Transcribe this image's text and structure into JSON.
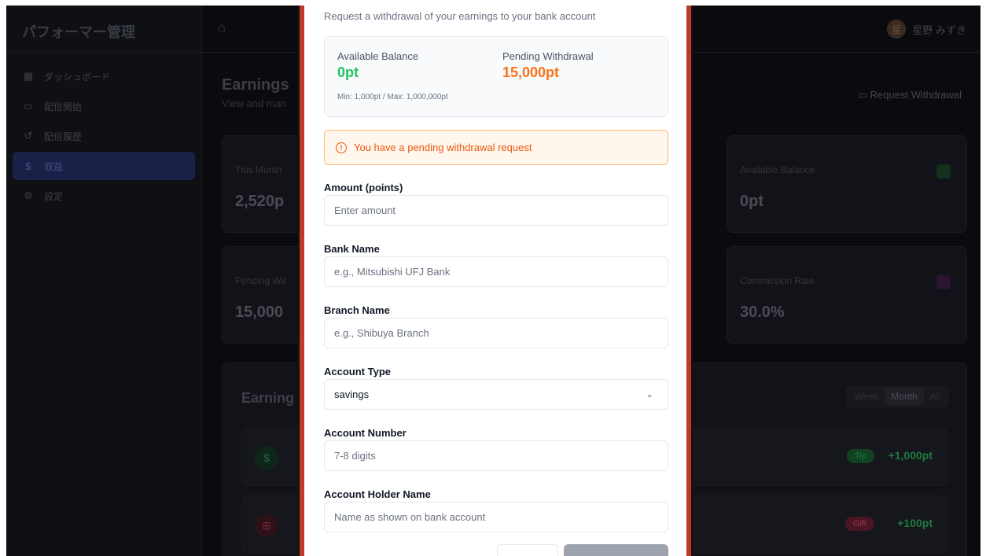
{
  "app": {
    "brand": "パフォーマー管理",
    "nav": [
      {
        "icon": "dashboard-icon",
        "label": "ダッシュボード"
      },
      {
        "icon": "video-icon",
        "label": "配信開始"
      },
      {
        "icon": "history-icon",
        "label": "配信履歴"
      },
      {
        "icon": "dollar-icon",
        "label": "収益"
      },
      {
        "icon": "gear-icon",
        "label": "設定"
      }
    ],
    "user": {
      "avatar": "星",
      "name": "星野 みずき"
    },
    "page_title": "Earnings",
    "page_subtitle": "View and man",
    "request_button": "Request Withdrawal",
    "cards": [
      {
        "label": "This Month",
        "value": "2,520p"
      },
      {
        "label": "Available Balance",
        "value": "0pt"
      },
      {
        "label": "Pending Wit",
        "value": "15,000"
      },
      {
        "label": "Commission Rate",
        "value": "30.0%"
      }
    ],
    "history": {
      "title": "Earning",
      "filters": [
        "Week",
        "Month",
        "All"
      ],
      "active_filter": "Month",
      "rows": [
        {
          "badge": "Tip",
          "amount": "+1,000pt"
        },
        {
          "badge": "Gift",
          "amount": "+100pt"
        }
      ]
    }
  },
  "modal": {
    "description": "Request a withdrawal of your earnings to your bank account",
    "available_label": "Available Balance",
    "available_value": "0pt",
    "pending_label": "Pending Withdrawal",
    "pending_value": "15,000pt",
    "limits": "Min: 1,000pt / Max: 1,000,000pt",
    "warning": "You have a pending withdrawal request",
    "fields": {
      "amount": {
        "label": "Amount (points)",
        "placeholder": "Enter amount"
      },
      "bank": {
        "label": "Bank Name",
        "placeholder": "e.g., Mitsubishi UFJ Bank"
      },
      "branch": {
        "label": "Branch Name",
        "placeholder": "e.g., Shibuya Branch"
      },
      "account_type": {
        "label": "Account Type",
        "value": "savings"
      },
      "account_number": {
        "label": "Account Number",
        "placeholder": "7-8 digits"
      },
      "holder": {
        "label": "Account Holder Name",
        "placeholder": "Name as shown on bank account"
      }
    },
    "colors": {
      "available": "#22c55e",
      "pending": "#f97316",
      "warning": "#ea580c"
    }
  }
}
